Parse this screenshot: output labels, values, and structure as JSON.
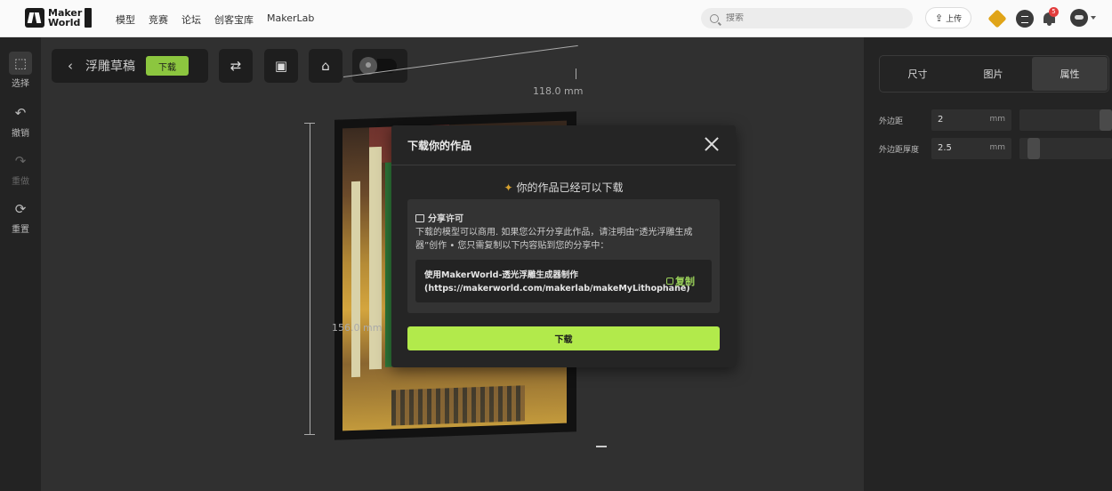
{
  "topnav": {
    "logo_line1": "Maker",
    "logo_line2": "World",
    "links": [
      "模型",
      "竞赛",
      "论坛",
      "创客宝库",
      "MakerLab"
    ],
    "search_placeholder": "搜索",
    "upload_label": "上传",
    "notification_count": "5"
  },
  "left_tools": [
    {
      "label": "选择",
      "icon": "select-icon"
    },
    {
      "label": "撤销",
      "icon": "undo-icon"
    },
    {
      "label": "重做",
      "icon": "redo-icon"
    },
    {
      "label": "重置",
      "icon": "reset-icon"
    }
  ],
  "canvas": {
    "draft_title": "浮雕草稿",
    "download_small": "下载",
    "width_label": "118.0 mm",
    "height_label": "156.0 mm"
  },
  "modal": {
    "title": "下载你的作品",
    "ready_text": "你的作品已经可以下载",
    "license_heading": "分享许可",
    "license_text": "下载的模型可以商用. 如果您公开分享此作品，请注明由“透光浮雕生成器”创作 • 您只需复制以下内容贴到您的分享中：",
    "credit_line1": "使用MakerWorld-透光浮雕生成器制作",
    "credit_line2": "(https://makerworld.com/makerlab/makeMyLithophane)",
    "copy_label": "复制",
    "download_label": "下载"
  },
  "right_panel": {
    "tabs": [
      "尺寸",
      "图片",
      "属性"
    ],
    "active_tab": "属性",
    "params": [
      {
        "label": "外边距",
        "value": "2",
        "unit": "mm",
        "slider_fraction": 1.0
      },
      {
        "label": "外边距厚度",
        "value": "2.5",
        "unit": "mm",
        "slider_fraction": 0.1
      }
    ]
  },
  "colors": {
    "accent_green": "#b2ea4b",
    "download_small_green": "#8cc63f",
    "badge_red": "#e23c3c"
  }
}
